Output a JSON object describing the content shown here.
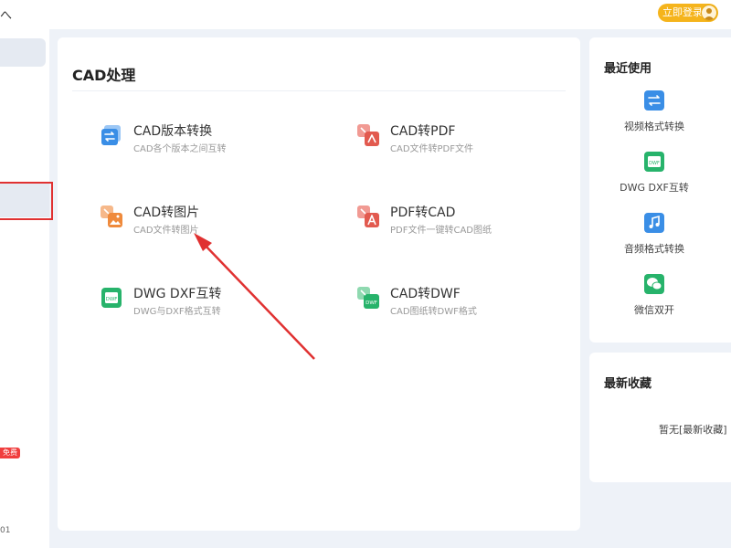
{
  "topbar": {
    "left_glyph": "へ",
    "login_label": "立即登录"
  },
  "sidebar": {
    "badge": "免费",
    "version": "01"
  },
  "main": {
    "title": "CAD处理",
    "tools": [
      {
        "name": "CAD版本转换",
        "desc": "CAD各个版本之间互转",
        "icon": "cad-version-convert-icon"
      },
      {
        "name": "CAD转PDF",
        "desc": "CAD文件转PDF文件",
        "icon": "cad-to-pdf-icon"
      },
      {
        "name": "CAD转图片",
        "desc": "CAD文件转图片",
        "icon": "cad-to-image-icon"
      },
      {
        "name": "PDF转CAD",
        "desc": "PDF文件一键转CAD图纸",
        "icon": "pdf-to-cad-icon"
      },
      {
        "name": "DWG DXF互转",
        "desc": "DWG与DXF格式互转",
        "icon": "dwg-dxf-convert-icon"
      },
      {
        "name": "CAD转DWF",
        "desc": "CAD图纸转DWF格式",
        "icon": "cad-to-dwf-icon"
      }
    ]
  },
  "recent": {
    "title": "最近使用",
    "items": [
      {
        "label": "视频格式转换",
        "icon": "video-convert-icon"
      },
      {
        "label": "DWG DXF互转",
        "icon": "dwg-dxf-convert-icon"
      },
      {
        "label": "音频格式转换",
        "icon": "audio-convert-icon"
      },
      {
        "label": "微信双开",
        "icon": "wechat-icon"
      }
    ]
  },
  "favorites": {
    "title": "最新收藏",
    "empty_text": "暂无[最新收藏]"
  },
  "colors": {
    "accent_blue": "#3a8ee6",
    "cad_red": "#e25a4f",
    "image_orange": "#ef8a3c",
    "dwg_green": "#27b36b",
    "login_yellow": "#f5b41c",
    "annotation_red": "#e03131"
  }
}
